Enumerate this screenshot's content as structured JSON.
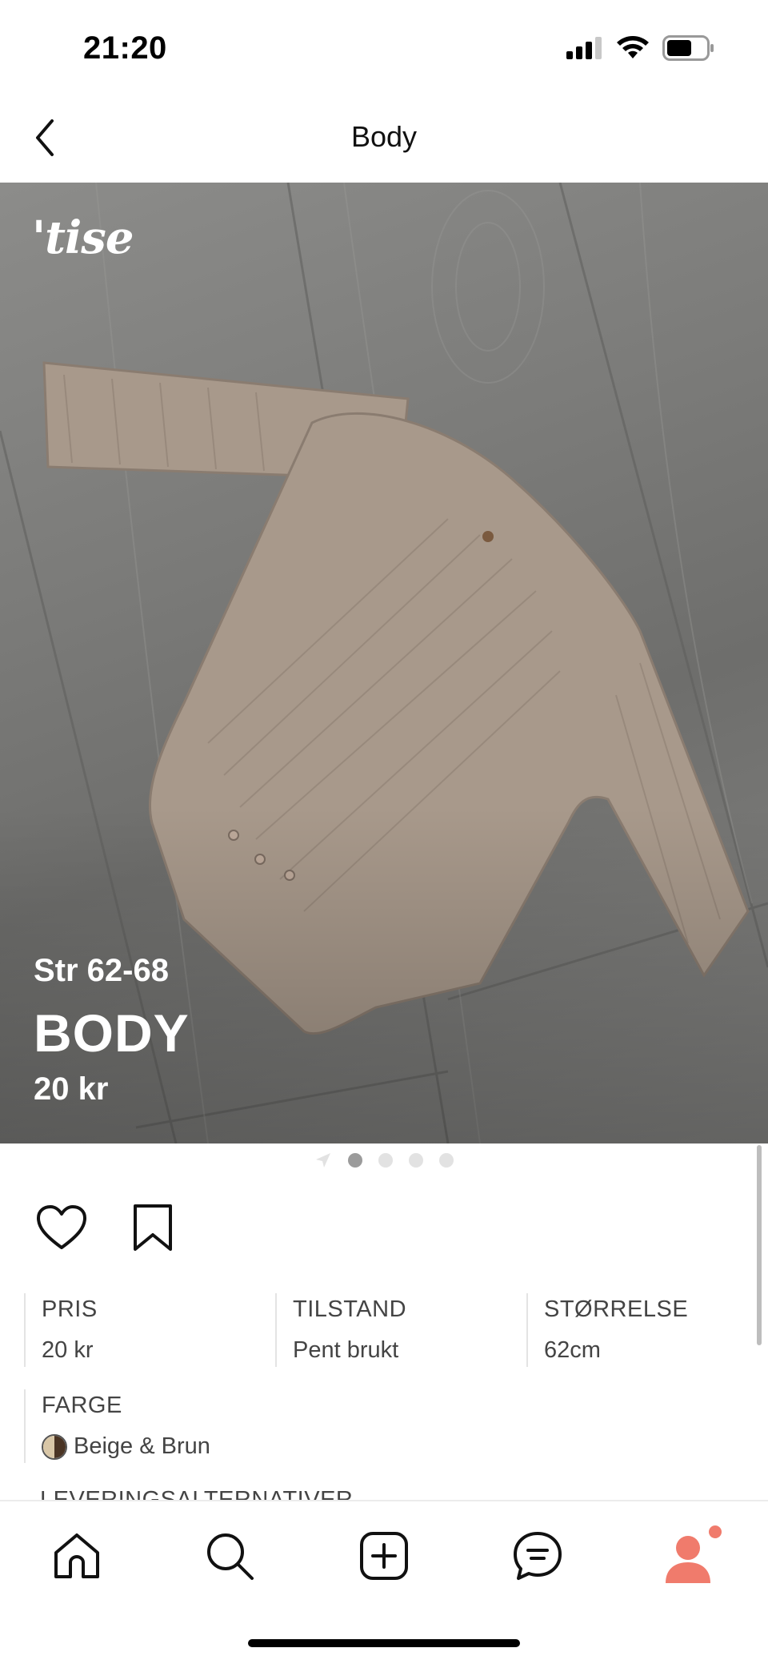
{
  "status_bar": {
    "time": "21:20",
    "icons": [
      "cellular-signal-icon",
      "wifi-icon",
      "battery-icon"
    ]
  },
  "nav": {
    "back_icon": "chevron-left-icon",
    "title": "Body"
  },
  "product": {
    "watermark": "'tise",
    "size_text": "Str 62-68",
    "name": "BODY",
    "price_text": "20 kr",
    "image_count": 4,
    "active_image_index": 0
  },
  "actions": {
    "like_icon": "heart-icon",
    "save_icon": "bookmark-icon"
  },
  "details": [
    {
      "label": "PRIS",
      "value": "20 kr"
    },
    {
      "label": "TILSTAND",
      "value": "Pent brukt"
    },
    {
      "label": "STØRRELSE",
      "value": "62cm"
    }
  ],
  "color": {
    "label": "FARGE",
    "value": "Beige & Brun",
    "swatch": [
      "#d9c7a7",
      "#4a3424"
    ]
  },
  "next_section_label": "LEVERINGSALTERNATIVER",
  "tab_bar": {
    "items": [
      "home-icon",
      "search-icon",
      "add-icon",
      "messages-icon",
      "profile-icon"
    ],
    "accent_color": "#f07b6c",
    "profile_has_notification": true
  }
}
